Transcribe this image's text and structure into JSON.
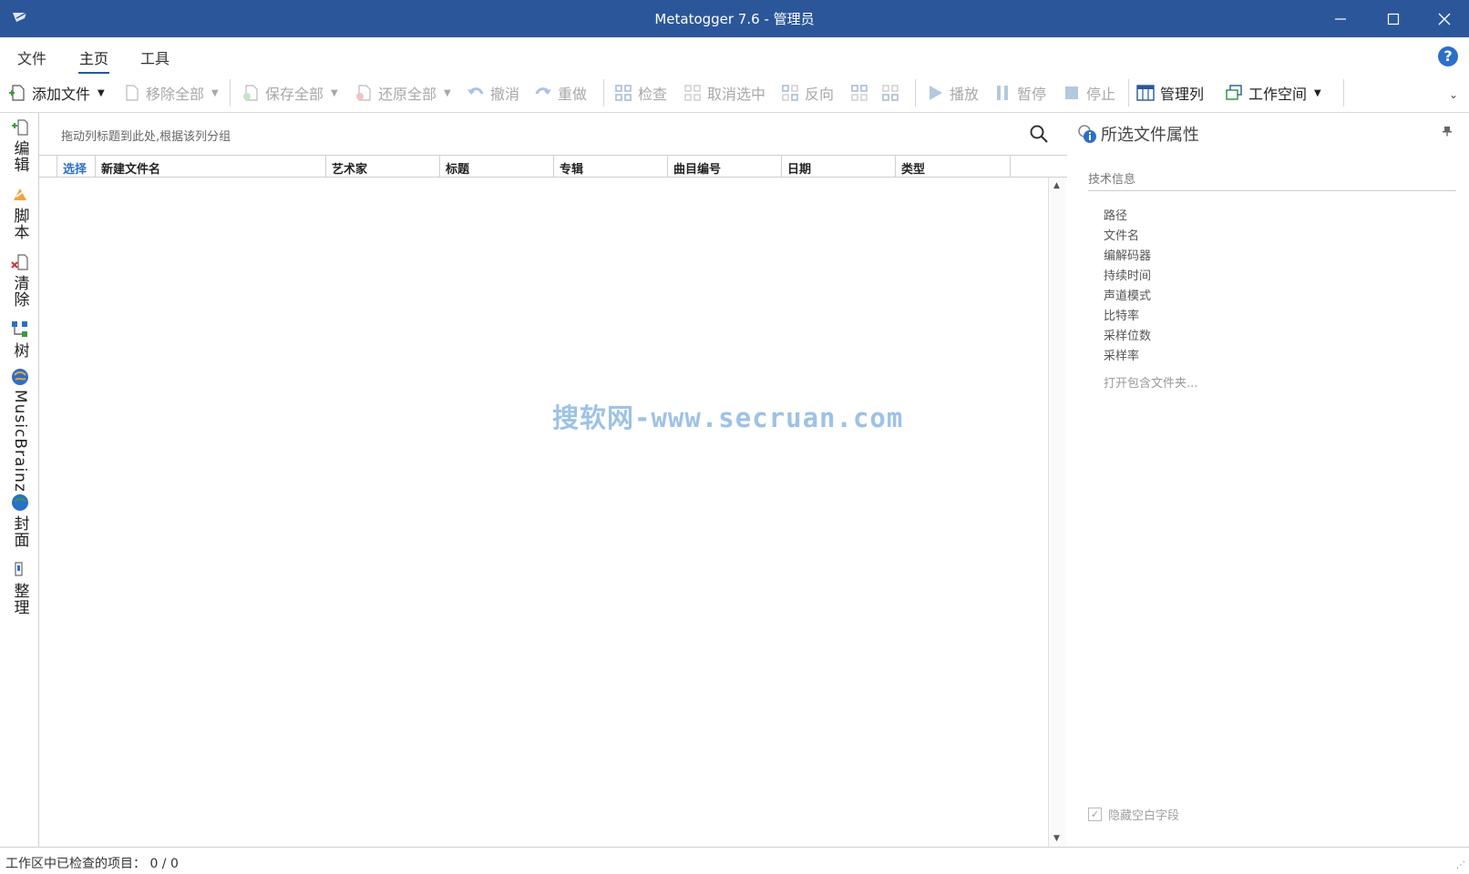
{
  "window": {
    "title": "Metatogger 7.6 - 管理员",
    "minimize_glyph": "—",
    "maximize_glyph": "☐",
    "close_glyph": "✕"
  },
  "menu": {
    "tabs": [
      {
        "label": "文件"
      },
      {
        "label": "主页"
      },
      {
        "label": "工具"
      }
    ],
    "help_glyph": "?"
  },
  "toolbar": {
    "add_files": "添加文件",
    "remove_all": "移除全部",
    "save_all": "保存全部",
    "restore_all": "还原全部",
    "undo": "撤消",
    "redo": "重做",
    "check": "检查",
    "uncheck": "取消选中",
    "invert": "反向",
    "play": "播放",
    "pause": "暂停",
    "stop": "停止",
    "manage_columns": "管理列",
    "workspace": "工作空间",
    "dropdown_glyph": "▼",
    "collapse_glyph": "⌄"
  },
  "sidebar": {
    "items": [
      {
        "label": "编辑",
        "icon": "edit-tag-icon"
      },
      {
        "label": "脚本",
        "icon": "script-icon"
      },
      {
        "label": "清除",
        "icon": "clean-icon"
      },
      {
        "label": "树",
        "icon": "tree-icon"
      },
      {
        "label": "MusicBrainz",
        "icon": "musicbrainz-icon"
      },
      {
        "label": "封面",
        "icon": "cover-icon"
      },
      {
        "label": "整理",
        "icon": "organize-icon"
      }
    ]
  },
  "grid": {
    "group_hint": "拖动列标题到此处,根据该列分组",
    "columns": [
      "选择",
      "新建文件名",
      "艺术家",
      "标题",
      "专辑",
      "曲目编号",
      "日期",
      "类型"
    ],
    "scroll_up": "▲",
    "scroll_down": "▼",
    "watermark": "搜软网-www.secruan.com"
  },
  "properties": {
    "title": "所选文件属性",
    "pin_glyph": "📌",
    "section": "技术信息",
    "fields": [
      "路径",
      "文件名",
      "编解码器",
      "持续时间",
      "声道模式",
      "比特率",
      "采样位数",
      "采样率"
    ],
    "open_folder": "打开包含文件夹...",
    "hide_empty": "隐藏空白字段",
    "hide_empty_checked": true,
    "check_glyph": "✓"
  },
  "status": {
    "label": "工作区中已检查的项目：",
    "value": "0 / 0",
    "grip": "⋰"
  },
  "colors": {
    "titlebar": "#2b579a",
    "accent": "#2b6fc7",
    "disabled_text": "#a8a8a8"
  }
}
